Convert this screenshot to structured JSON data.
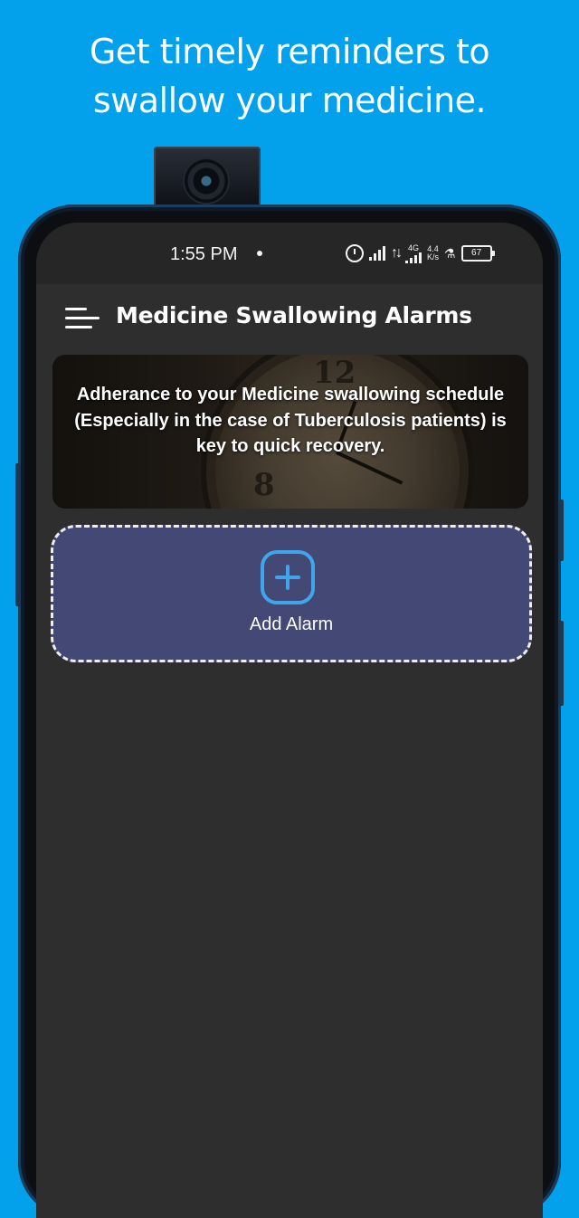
{
  "promo": {
    "line1": "Get timely reminders to",
    "line2": "swallow your medicine."
  },
  "status_bar": {
    "time": "1:55 PM",
    "network_type": "4G",
    "speed_value": "4.4",
    "speed_unit": "K/s",
    "battery": "67",
    "icons": [
      "alarm-icon",
      "signal-icon",
      "data-arrows-icon",
      "signal-icon",
      "flask-icon",
      "battery-icon"
    ]
  },
  "app_bar": {
    "title": "Medicine Swallowing Alarms",
    "menu_icon": "menu-icon"
  },
  "banner": {
    "text": "Adherance to your Medicine swallowing schedule (Especially in the case of Tuberculosis patients) is key to quick recovery.",
    "clock_numbers": [
      "12",
      "8"
    ]
  },
  "add_alarm": {
    "label": "Add Alarm",
    "icon": "add-square-icon"
  },
  "colors": {
    "background": "#03A0EC",
    "screen": "#2E2E2E",
    "card": "#434874",
    "accent": "#3FA6EE"
  }
}
